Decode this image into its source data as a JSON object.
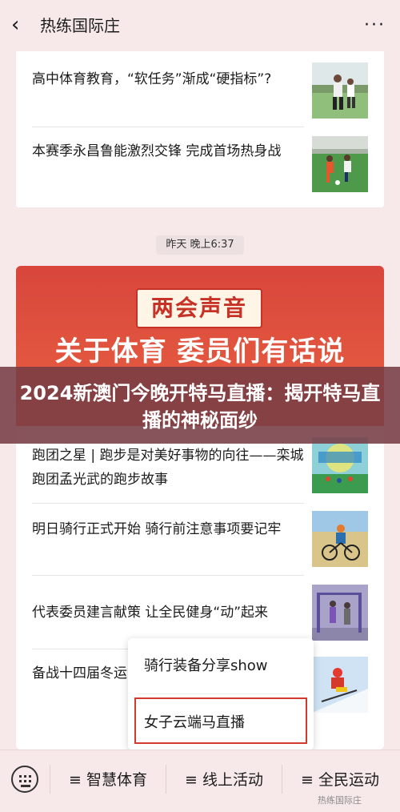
{
  "nav": {
    "back_icon": "‹",
    "title": "热练国际庄",
    "more_icon": "···"
  },
  "card1": {
    "articles": [
      {
        "title": "高中体育教育，“软任务”渐成“硬指标”?"
      },
      {
        "title": "本赛季永昌鲁能激烈交锋 完成首场热身战"
      }
    ]
  },
  "timestamp": "昨天 晚上6:37",
  "banner": {
    "tag": "两会声音",
    "headline": "关于体育 委员们有话说"
  },
  "overlay": {
    "text": "2024新澳门今晚开特马直播：揭开特马直播的神秘面纱"
  },
  "card2": {
    "articles": [
      {
        "title": "跑团之星 | 跑步是对美好事物的向往——栾城跑团孟光武的跑步故事"
      },
      {
        "title": "明日骑行正式开始 骑行前注意事项要记牢"
      },
      {
        "title": "代表委员建言献策 让全民健身“动”起来"
      },
      {
        "title": "备战十四届冬运会 全面展开"
      }
    ]
  },
  "popup": {
    "items": [
      "骑行装备分享show",
      "女子云端马直播"
    ]
  },
  "bottom_menu": {
    "keyboard_icon": "keyboard",
    "items": [
      "≡ 智慧体育",
      "≡ 线上活动",
      "≡ 全民运动"
    ]
  },
  "watermark": "热练国际庄",
  "colors": {
    "accent": "#d23a2e",
    "banner": "#d8463c",
    "overlay": "#783c46"
  }
}
